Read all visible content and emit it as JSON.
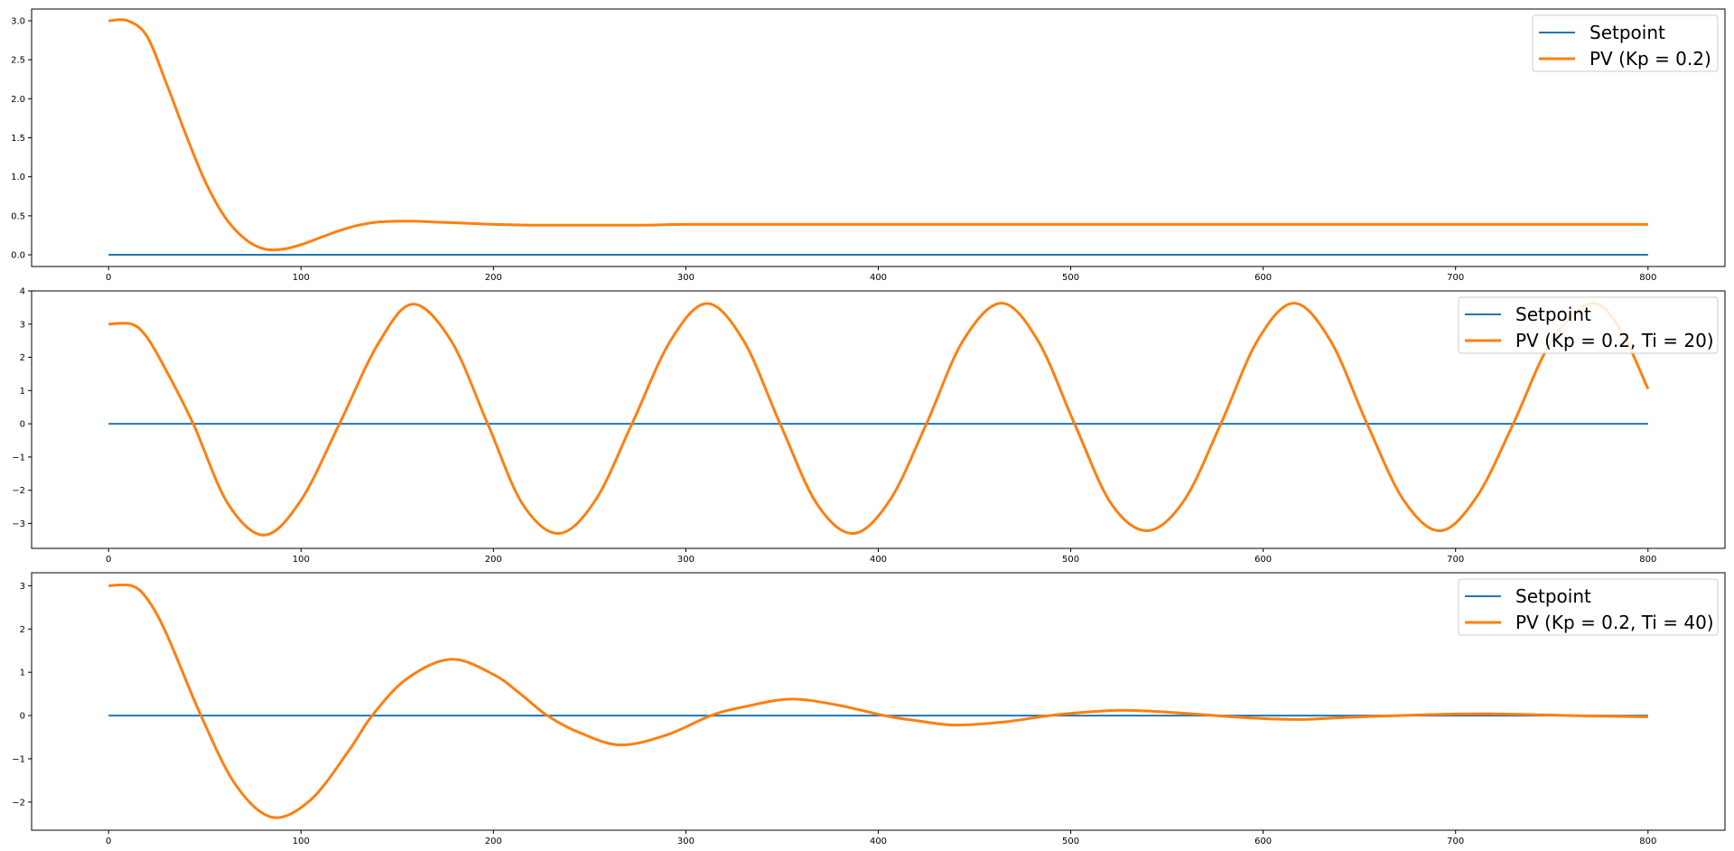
{
  "colors": {
    "setpoint": "#1f77b4",
    "pv": "#ff7f0e",
    "frame": "#000000",
    "legend_border": "#cccccc"
  },
  "chart_data": [
    {
      "type": "line",
      "title": "",
      "xlabel": "",
      "ylabel": "",
      "grid": false,
      "legend_placement": "top-right",
      "xlim": [
        -40,
        840
      ],
      "ylim": [
        -0.15,
        3.15
      ],
      "xticks": [
        0,
        100,
        200,
        300,
        400,
        500,
        600,
        700,
        800
      ],
      "xtick_labels": [
        "0",
        "100",
        "200",
        "300",
        "400",
        "500",
        "600",
        "700",
        "800"
      ],
      "yticks": [
        0,
        0.5,
        1,
        1.5,
        2,
        2.5,
        3
      ],
      "ytick_labels": [
        "0.0",
        "0.5",
        "1.0",
        "1.5",
        "2.0",
        "2.5",
        "3.0"
      ],
      "series": [
        {
          "name": "Setpoint",
          "color": "#1f77b4",
          "x": [
            0,
            800
          ],
          "y": [
            0,
            0
          ]
        },
        {
          "name": "PV (Kp = 0.2)",
          "color": "#ff7f0e",
          "x": [
            0,
            10,
            20,
            30,
            40,
            50,
            60,
            70,
            80,
            90,
            100,
            110,
            120,
            130,
            140,
            150,
            160,
            170,
            180,
            190,
            200,
            220,
            240,
            260,
            280,
            300,
            350,
            400,
            500,
            600,
            700,
            800
          ],
          "y": [
            3.0,
            3.0,
            2.8,
            2.2,
            1.55,
            0.95,
            0.5,
            0.22,
            0.08,
            0.07,
            0.13,
            0.22,
            0.31,
            0.38,
            0.42,
            0.43,
            0.43,
            0.42,
            0.41,
            0.4,
            0.39,
            0.38,
            0.38,
            0.38,
            0.38,
            0.39,
            0.39,
            0.39,
            0.39,
            0.39,
            0.39,
            0.39
          ]
        }
      ]
    },
    {
      "type": "line",
      "title": "",
      "xlabel": "",
      "ylabel": "",
      "grid": false,
      "legend_placement": "top-right",
      "xlim": [
        -40,
        840
      ],
      "ylim": [
        -3.75,
        4.0
      ],
      "xticks": [
        0,
        100,
        200,
        300,
        400,
        500,
        600,
        700,
        800
      ],
      "xtick_labels": [
        "0",
        "100",
        "200",
        "300",
        "400",
        "500",
        "600",
        "700",
        "800"
      ],
      "yticks": [
        -3,
        -2,
        -1,
        0,
        1,
        2,
        3,
        4
      ],
      "ytick_labels": [
        "−3",
        "−2",
        "−1",
        "0",
        "1",
        "2",
        "3",
        "4"
      ],
      "series": [
        {
          "name": "Setpoint",
          "color": "#1f77b4",
          "x": [
            0,
            800
          ],
          "y": [
            0,
            0
          ]
        },
        {
          "name": "PV (Kp = 0.2, Ti = 20)",
          "color": "#ff7f0e",
          "x": [
            0,
            12,
            20,
            30,
            44,
            62,
            81,
            100,
            120,
            140,
            158,
            178,
            197,
            215,
            234,
            253,
            272,
            292,
            311,
            330,
            349,
            368,
            387,
            406,
            425,
            444,
            464,
            483,
            502,
            521,
            540,
            559,
            578,
            597,
            616,
            635,
            654,
            673,
            692,
            711,
            730,
            749,
            770,
            785,
            800
          ],
          "y": [
            3.0,
            3.0,
            2.6,
            1.6,
            0.0,
            -2.4,
            -3.35,
            -2.3,
            0.0,
            2.4,
            3.6,
            2.5,
            0.0,
            -2.4,
            -3.3,
            -2.3,
            0.0,
            2.5,
            3.62,
            2.5,
            0.0,
            -2.4,
            -3.3,
            -2.3,
            0.0,
            2.5,
            3.63,
            2.5,
            0.0,
            -2.4,
            -3.22,
            -2.3,
            0.0,
            2.5,
            3.63,
            2.5,
            0.0,
            -2.3,
            -3.22,
            -2.2,
            0.0,
            2.4,
            3.62,
            2.9,
            1.05
          ]
        }
      ]
    },
    {
      "type": "line",
      "title": "",
      "xlabel": "",
      "ylabel": "",
      "grid": false,
      "legend_placement": "top-right",
      "xlim": [
        -40,
        840
      ],
      "ylim": [
        -2.65,
        3.3
      ],
      "xticks": [
        0,
        100,
        200,
        300,
        400,
        500,
        600,
        700,
        800
      ],
      "xtick_labels": [
        "0",
        "100",
        "200",
        "300",
        "400",
        "500",
        "600",
        "700",
        "800"
      ],
      "yticks": [
        -2,
        -1,
        0,
        1,
        2,
        3
      ],
      "ytick_labels": [
        "−2",
        "−1",
        "0",
        "1",
        "2",
        "3"
      ],
      "series": [
        {
          "name": "Setpoint",
          "color": "#1f77b4",
          "x": [
            0,
            800
          ],
          "y": [
            0,
            0
          ]
        },
        {
          "name": "PV (Kp = 0.2, Ti = 40)",
          "color": "#ff7f0e",
          "x": [
            0,
            12,
            20,
            30,
            48,
            66,
            85,
            105,
            125,
            137,
            155,
            178,
            200,
            214,
            228,
            245,
            266,
            290,
            313,
            330,
            354,
            378,
            403,
            420,
            440,
            465,
            489,
            505,
            527,
            550,
            575,
            595,
            620,
            645,
            670,
            695,
            720,
            760,
            800
          ],
          "y": [
            3.0,
            3.0,
            2.7,
            1.9,
            0.0,
            -1.6,
            -2.35,
            -1.95,
            -0.8,
            0.0,
            0.85,
            1.3,
            0.95,
            0.5,
            0.0,
            -0.4,
            -0.68,
            -0.45,
            0.0,
            0.2,
            0.38,
            0.25,
            0.0,
            -0.12,
            -0.22,
            -0.15,
            0.0,
            0.07,
            0.12,
            0.08,
            0.0,
            -0.06,
            -0.09,
            -0.04,
            0.0,
            0.03,
            0.04,
            0.0,
            -0.03
          ]
        }
      ]
    }
  ]
}
